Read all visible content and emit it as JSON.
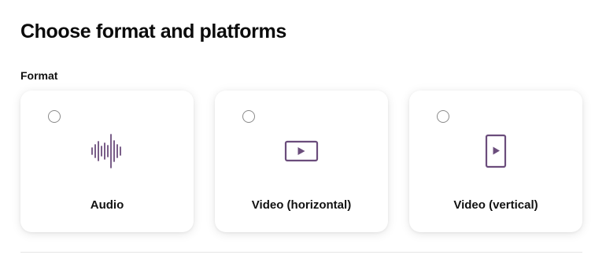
{
  "page": {
    "title": "Choose format and platforms"
  },
  "format": {
    "section_label": "Format",
    "accent_color": "#6b4d7c",
    "selected": null,
    "options": [
      {
        "label": "Audio",
        "icon": "audio-waveform-icon"
      },
      {
        "label": "Video (horizontal)",
        "icon": "video-horizontal-icon"
      },
      {
        "label": "Video (vertical)",
        "icon": "video-vertical-icon"
      }
    ]
  }
}
